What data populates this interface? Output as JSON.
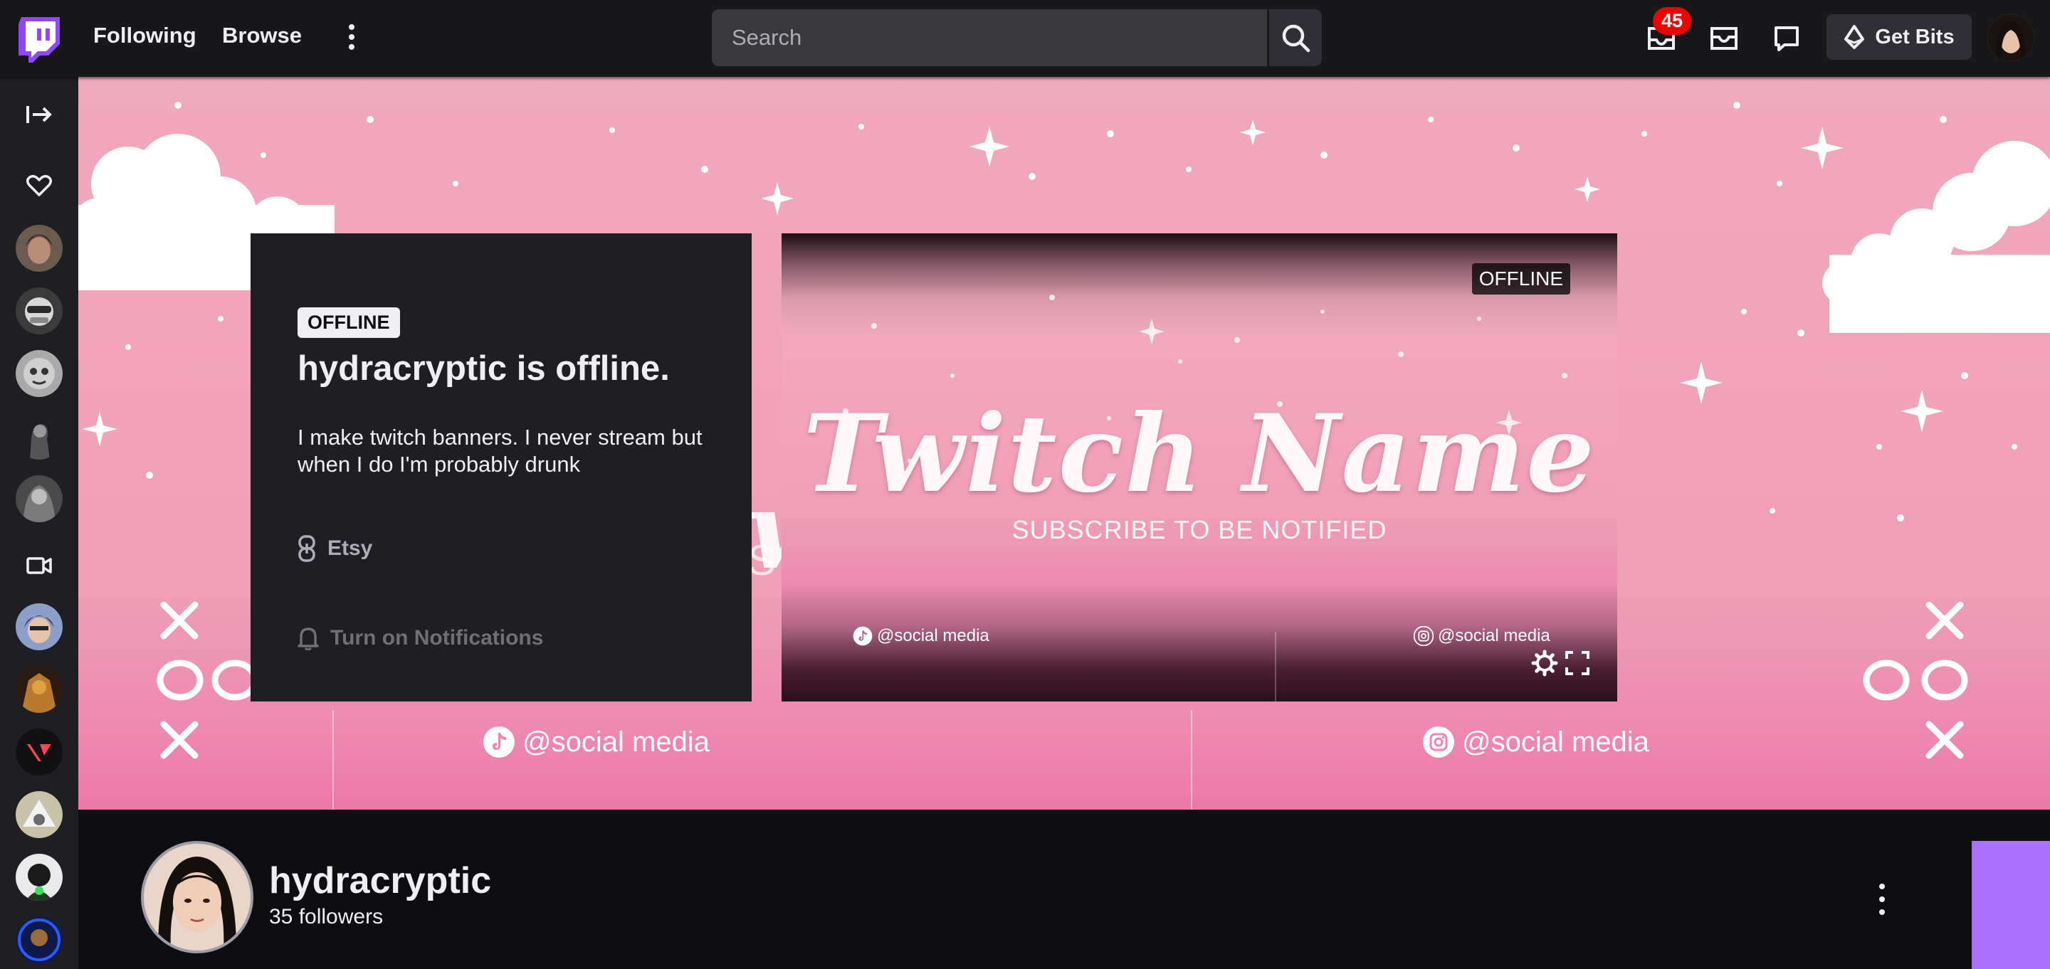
{
  "topnav": {
    "following_label": "Following",
    "browse_label": "Browse",
    "search_placeholder": "Search",
    "notifications_count": "45",
    "get_bits_label": "Get Bits"
  },
  "offline_card": {
    "status_tag": "OFFLINE",
    "title": "hydracryptic is offline.",
    "description": "I make twitch banners. I never stream but when I do I'm probably drunk",
    "link_label": "Etsy",
    "notify_label": "Turn on Notifications"
  },
  "player": {
    "status_tag": "OFFLINE",
    "title": "Twitch Name",
    "subtitle": "SUBSCRIBE TO BE NOTIFIED",
    "social_left": "@social media",
    "social_right": "@social media"
  },
  "banner": {
    "social_left": "@social media",
    "social_right": "@social media"
  },
  "channel": {
    "name": "hydracryptic",
    "followers": "35 followers"
  },
  "colors": {
    "twitch_purple": "#9147ff",
    "banner_pink": "#f0a8bd",
    "badge_red": "#eb0400",
    "dark_bg": "#0e0e10"
  },
  "icons": [
    "twitch-logo-icon",
    "more-icon",
    "search-icon",
    "inbox-icon",
    "mail-icon",
    "whispers-icon",
    "bits-icon",
    "collapse-icon",
    "heart-icon",
    "video-camera-icon",
    "link-icon",
    "bell-icon",
    "tiktok-icon",
    "instagram-icon",
    "settings-icon",
    "fullscreen-icon"
  ]
}
